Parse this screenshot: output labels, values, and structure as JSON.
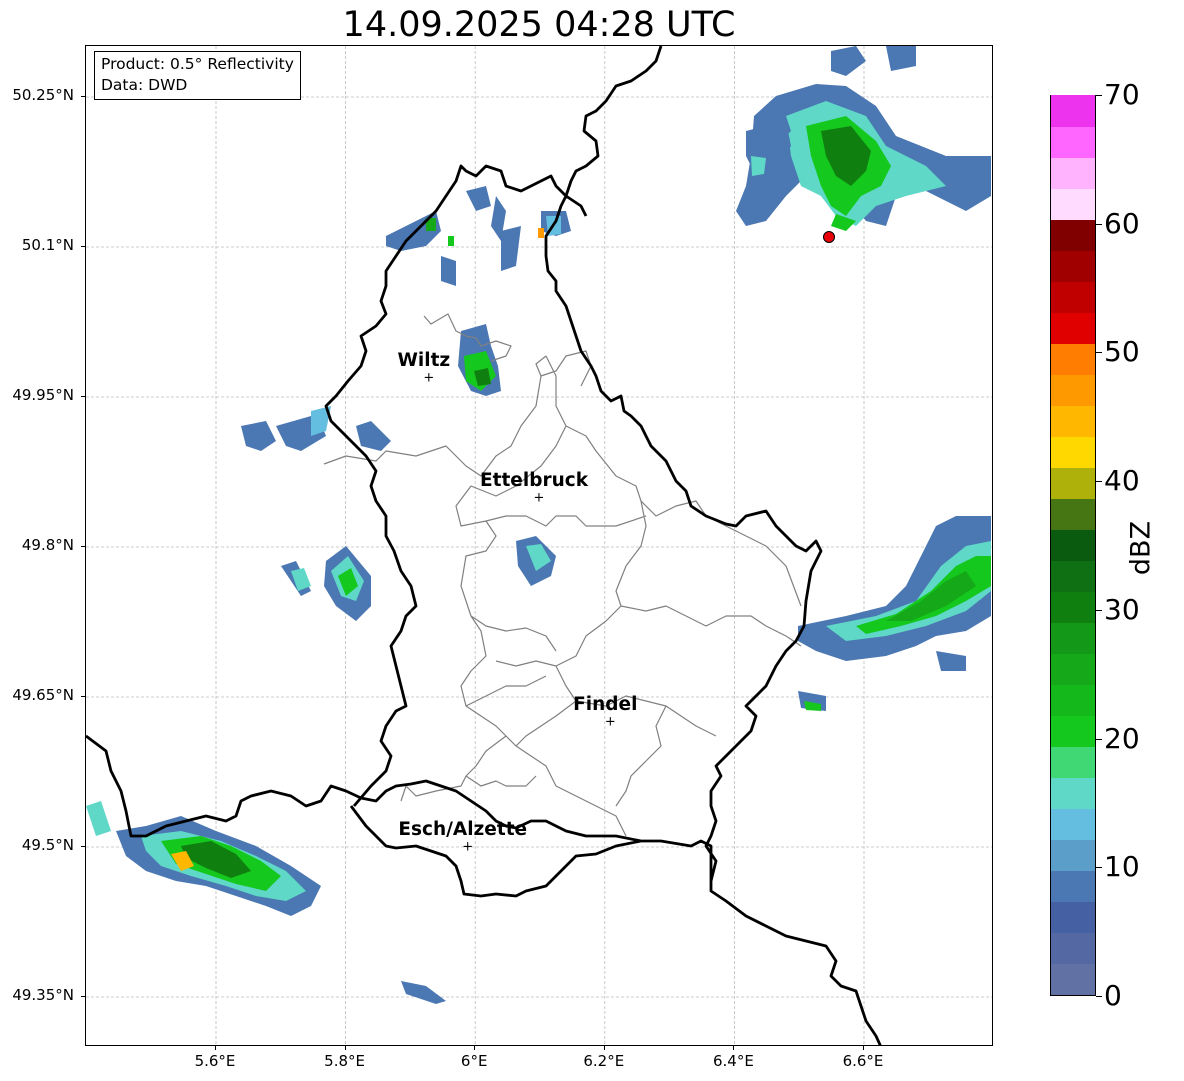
{
  "title": "14.09.2025 04:28 UTC",
  "info": {
    "product": "Product: 0.5° Reflectivity",
    "data": "Data: DWD"
  },
  "axes": {
    "lat_ticks": [
      {
        "label": "50.25°N",
        "value": 50.25
      },
      {
        "label": "50.1°N",
        "value": 50.1
      },
      {
        "label": "49.95°N",
        "value": 49.95
      },
      {
        "label": "49.8°N",
        "value": 49.8
      },
      {
        "label": "49.65°N",
        "value": 49.65
      },
      {
        "label": "49.5°N",
        "value": 49.5
      },
      {
        "label": "49.35°N",
        "value": 49.35
      }
    ],
    "lon_ticks": [
      {
        "label": "5.6°E",
        "value": 5.6
      },
      {
        "label": "5.8°E",
        "value": 5.8
      },
      {
        "label": "6°E",
        "value": 6.0
      },
      {
        "label": "6.2°E",
        "value": 6.2
      },
      {
        "label": "6.4°E",
        "value": 6.4
      },
      {
        "label": "6.6°E",
        "value": 6.6
      }
    ]
  },
  "cities": [
    {
      "name": "Wiltz",
      "lat": 49.968,
      "lon": 5.93
    },
    {
      "name": "Ettelbruck",
      "lat": 49.848,
      "lon": 6.1
    },
    {
      "name": "Findel",
      "lat": 49.624,
      "lon": 6.21
    },
    {
      "name": "Esch/Alzette",
      "lat": 49.499,
      "lon": 5.99
    }
  ],
  "radar_site": {
    "lat": 50.11,
    "lon": 6.55,
    "color": "#e8000b"
  },
  "colorbar": {
    "label": "dBZ",
    "min": 0,
    "max": 70,
    "ticks": [
      "0",
      "10",
      "20",
      "30",
      "40",
      "50",
      "60",
      "70"
    ],
    "colors": [
      "#6271a4",
      "#5469a3",
      "#4560a3",
      "#4b77b2",
      "#5a9ec9",
      "#63bedf",
      "#5fd8c8",
      "#3fd874",
      "#15c81e",
      "#15b81a",
      "#15a818",
      "#149818",
      "#0f8010",
      "#0e7012",
      "#0a5a0f",
      "#467514",
      "#aeb10a",
      "#ffd800",
      "#ffb700",
      "#ff9900",
      "#ff7d00",
      "#e00000",
      "#c00000",
      "#a00000",
      "#800000",
      "#ffdcff",
      "#ffb3ff",
      "#ff66ff",
      "#ee33ee"
    ]
  },
  "colors": {
    "border_thick": "#000000",
    "border_thin": "#808080",
    "grid": "#bdbdbd"
  }
}
